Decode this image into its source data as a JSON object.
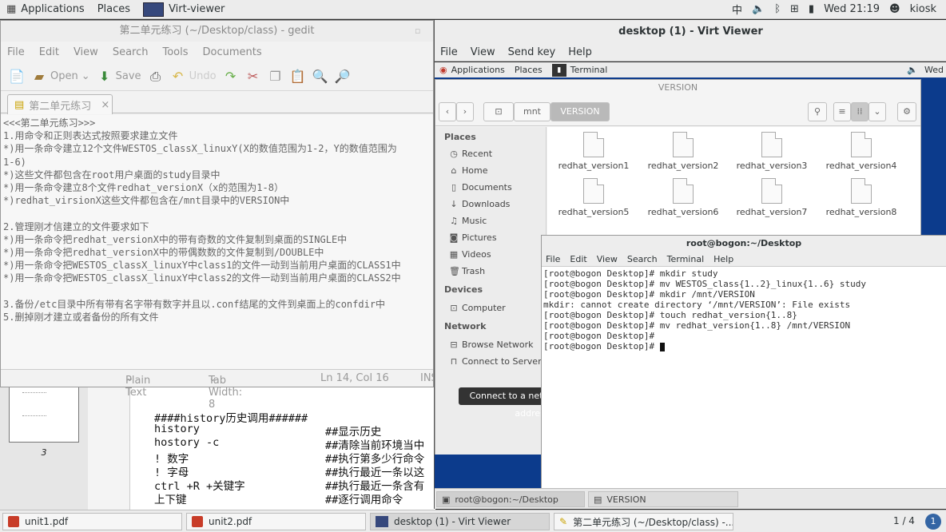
{
  "topbar": {
    "applications": "Applications",
    "places": "Places",
    "app": "Virt-viewer",
    "input_method": "中",
    "clock": "Wed 21:19",
    "user": "kiosk"
  },
  "gedit": {
    "title": "第二单元练习 (~/Desktop/class) - gedit",
    "menu": [
      "File",
      "Edit",
      "View",
      "Search",
      "Tools",
      "Documents"
    ],
    "toolbar": {
      "open": "Open",
      "save": "Save",
      "undo": "Undo"
    },
    "tab": "第二单元练习",
    "lines": [
      "<<<第二单元练习>>>",
      "1.用命令和正则表达式按照要求建立文件",
      "*)用一条命令建立12个文件WESTOS_classX_linuxY(X的数值范围为1-2，Y的数值范围为",
      "1-6)",
      "*)这些文件都包含在root用户桌面的study目录中",
      "*)用一条命令建立8个文件redhat_versionX（x的范围为1-8）",
      "*)redhat_virsionX这些文件都包含在/mnt目录中的VERSION中",
      "",
      "2.管理刚才信建立的文件要求如下",
      "*)用一条命令把redhat_versionX中的带有奇数的文件复制到桌面的SINGLE中",
      "*)用一条命令把redhat_versionX中的带偶数数的文件复制到/DOUBLE中",
      "*)用一条命令把WESTOS_classX_linuxY中class1的文件一动到当前用户桌面的CLASS1中",
      "*)用一条命令把WESTOS_classX_linuxY中class2的文件一动到当前用户桌面的CLASS2中",
      "",
      "3.备份/etc目录中所有带有名字带有数字并且以.conf结尾的文件到桌面上的confdir中",
      "5.删掉刚才建立或者备份的所有文件"
    ],
    "status": {
      "lang": "Plain Text",
      "tab_width": "Tab Width: 8",
      "position": "Ln 14, Col 16",
      "mode": "INS"
    }
  },
  "pdf": {
    "page_number": "3",
    "lines": [
      {
        "cmd": "####history历史调用######",
        "desc": ""
      },
      {
        "cmd": "history",
        "desc": "##显示历史"
      },
      {
        "cmd": "hostory -c",
        "desc": "##清除当前环境当中"
      },
      {
        "cmd": "! 数字",
        "desc": "##执行第多少行命令"
      },
      {
        "cmd": "! 字母",
        "desc": "##执行最近一条以这"
      },
      {
        "cmd": "ctrl +R +关键字",
        "desc": "##执行最近一条含有"
      },
      {
        "cmd": "上下键",
        "desc": "##逐行调用命令"
      }
    ]
  },
  "virtviewer": {
    "title": "desktop (1) - Virt Viewer",
    "menu": [
      "File",
      "View",
      "Send key",
      "Help"
    ],
    "guest_topbar": {
      "applications": "Applications",
      "places": "Places",
      "app": "Terminal",
      "clock": "Wed"
    },
    "nautilus": {
      "title": "VERSION",
      "path": [
        "mnt",
        "VERSION"
      ],
      "places_header": "Places",
      "places": [
        "Recent",
        "Home",
        "Documents",
        "Downloads",
        "Music",
        "Pictures",
        "Videos",
        "Trash"
      ],
      "devices_header": "Devices",
      "devices": [
        "Computer"
      ],
      "network_header": "Network",
      "network": [
        "Browse Network",
        "Connect to Server"
      ],
      "files": [
        "redhat_version1",
        "redhat_version2",
        "redhat_version3",
        "redhat_version4",
        "redhat_version5",
        "redhat_version6",
        "redhat_version7",
        "redhat_version8"
      ],
      "tooltip": "Connect to a network server address"
    },
    "terminal": {
      "title": "root@bogon:~/Desktop",
      "menu": [
        "File",
        "Edit",
        "View",
        "Search",
        "Terminal",
        "Help"
      ],
      "lines": [
        "[root@bogon Desktop]# mkdir study",
        "[root@bogon Desktop]# mv WESTOS_class{1..2}_linux{1..6} study",
        "[root@bogon Desktop]# mkdir /mnt/VERSION",
        "mkdir: cannot create directory ‘/mnt/VERSION’: File exists",
        "[root@bogon Desktop]# touch redhat_version{1..8}",
        "[root@bogon Desktop]# mv redhat_version{1..8} /mnt/VERSION",
        "[root@bogon Desktop]#",
        "[root@bogon Desktop]# "
      ]
    },
    "guest_tasks": [
      "root@bogon:~/Desktop",
      "VERSION"
    ]
  },
  "taskbar": {
    "items": [
      "unit1.pdf",
      "unit2.pdf",
      "desktop (1) - Virt Viewer",
      "第二单元练习 (~/Desktop/class) -..."
    ],
    "workspace": "1 / 4"
  }
}
